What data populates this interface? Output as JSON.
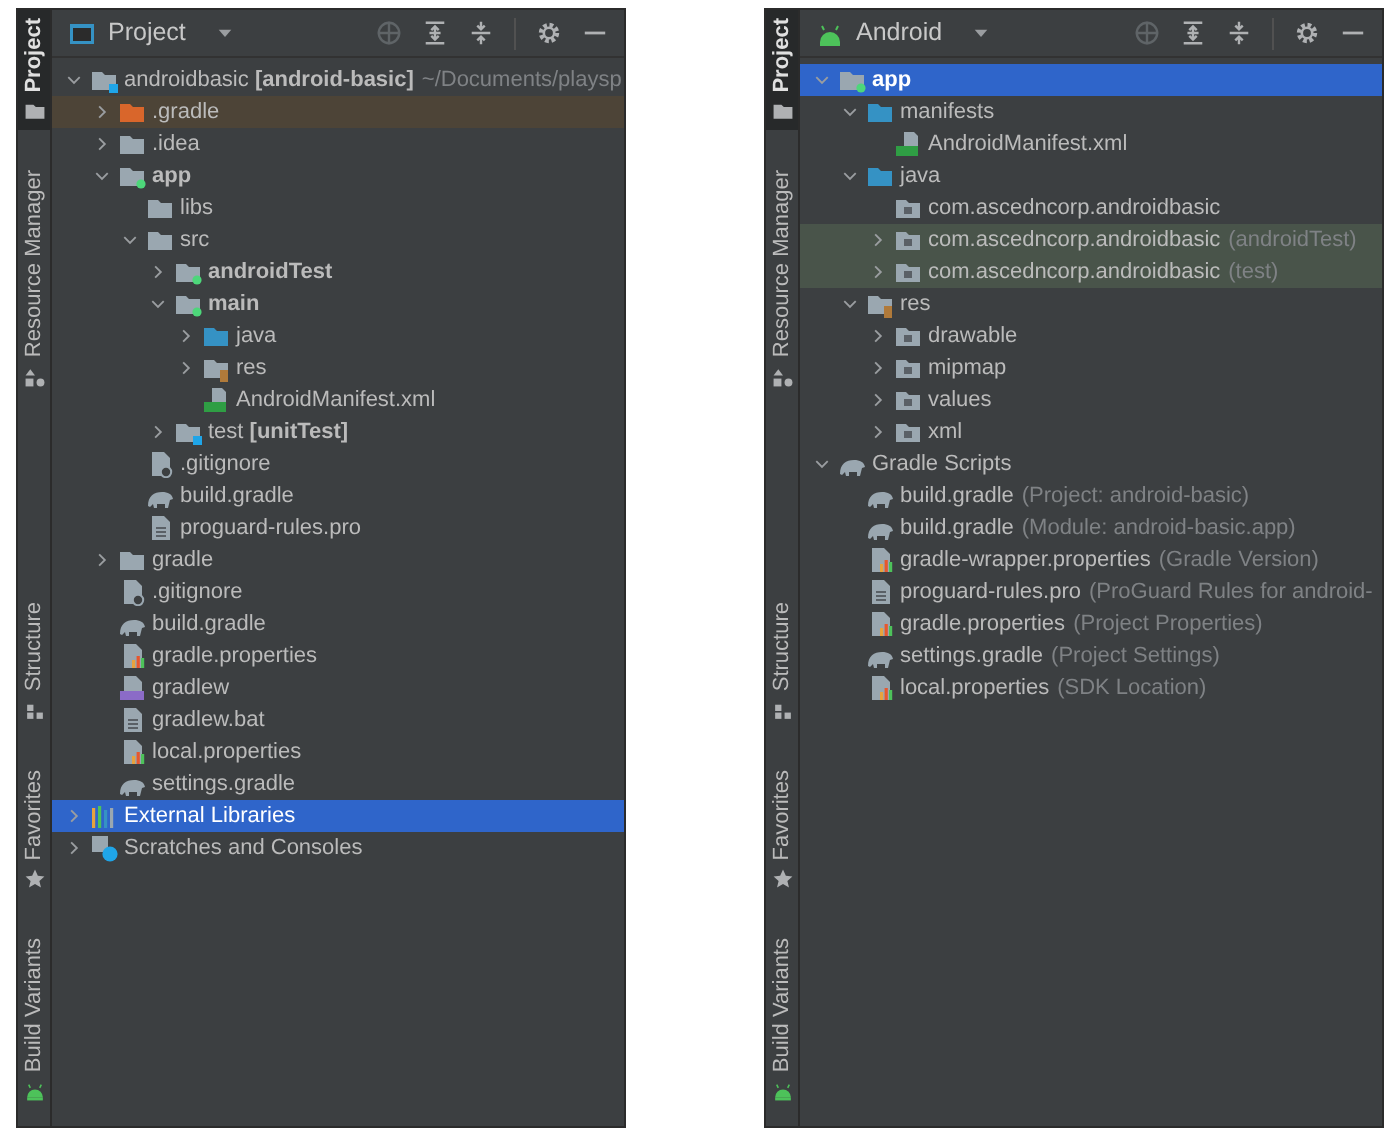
{
  "panels": [
    {
      "sidebar": {
        "top": [
          {
            "label": "Project",
            "kind": "folder",
            "selected": true
          },
          {
            "label": "Resource Manager",
            "kind": "shapes",
            "selected": false
          }
        ],
        "bottom": [
          {
            "label": "Structure",
            "kind": "structure",
            "selected": false
          },
          {
            "label": "Favorites",
            "kind": "star",
            "selected": false
          },
          {
            "label": "Build Variants",
            "kind": "android",
            "selected": false
          }
        ]
      },
      "view": {
        "label": "Project",
        "kind": "window"
      },
      "tree": [
        {
          "label": "androidbasic **[android-basic]**",
          "hint": "~/Documents/playsp",
          "kind": "module-blue",
          "expanded": true,
          "selected": false,
          "children": [
            {
              "label": ".gradle",
              "kind": "excluded",
              "expanded": false,
              "selected": false
            },
            {
              "label": ".idea",
              "kind": "folder",
              "expanded": false,
              "selected": false
            },
            {
              "label": "app",
              "bold": true,
              "kind": "module-green",
              "expanded": true,
              "selected": false,
              "children": [
                {
                  "label": "libs",
                  "kind": "folder",
                  "selected": false
                },
                {
                  "label": "src",
                  "kind": "folder",
                  "expanded": true,
                  "selected": false,
                  "children": [
                    {
                      "label": "androidTest",
                      "bold": true,
                      "kind": "module-green",
                      "expanded": false,
                      "selected": false
                    },
                    {
                      "label": "main",
                      "bold": true,
                      "kind": "module-green",
                      "expanded": true,
                      "selected": false,
                      "children": [
                        {
                          "label": "java",
                          "kind": "source-folder",
                          "expanded": false,
                          "selected": false
                        },
                        {
                          "label": "res",
                          "kind": "resource-folder",
                          "expanded": false,
                          "selected": false
                        },
                        {
                          "label": "AndroidManifest.xml",
                          "kind": "manifest",
                          "selected": false
                        }
                      ]
                    },
                    {
                      "label": "test **[unitTest]**",
                      "kind": "module-blue",
                      "expanded": false,
                      "selected": false
                    }
                  ]
                },
                {
                  "label": ".gitignore",
                  "kind": "ignore",
                  "selected": false
                },
                {
                  "label": "build.gradle",
                  "kind": "gradle",
                  "selected": false
                },
                {
                  "label": "proguard-rules.pro",
                  "kind": "file",
                  "selected": false
                }
              ]
            },
            {
              "label": "gradle",
              "kind": "folder",
              "expanded": false,
              "selected": false
            },
            {
              "label": ".gitignore",
              "kind": "ignore",
              "selected": false
            },
            {
              "label": "build.gradle",
              "kind": "gradle",
              "selected": false
            },
            {
              "label": "gradle.properties",
              "kind": "properties",
              "selected": false
            },
            {
              "label": "gradlew",
              "kind": "script",
              "selected": false
            },
            {
              "label": "gradlew.bat",
              "kind": "file",
              "selected": false
            },
            {
              "label": "local.properties",
              "kind": "properties",
              "selected": false
            },
            {
              "label": "settings.gradle",
              "kind": "gradle",
              "selected": false
            }
          ]
        },
        {
          "label": "External Libraries",
          "kind": "library",
          "expanded": false,
          "selected": true
        },
        {
          "label": "Scratches and Consoles",
          "kind": "scratch",
          "expanded": false,
          "selected": false
        }
      ]
    },
    {
      "sidebar": {
        "top": [
          {
            "label": "Project",
            "kind": "folder",
            "selected": true
          },
          {
            "label": "Resource Manager",
            "kind": "shapes",
            "selected": false
          }
        ],
        "bottom": [
          {
            "label": "Structure",
            "kind": "structure",
            "selected": false
          },
          {
            "label": "Favorites",
            "kind": "star",
            "selected": false
          },
          {
            "label": "Build Variants",
            "kind": "android",
            "selected": false
          }
        ]
      },
      "view": {
        "label": "Android",
        "kind": "android"
      },
      "tree": [
        {
          "label": "app",
          "bold": true,
          "kind": "module-green",
          "expanded": true,
          "selected": true,
          "children": [
            {
              "label": "manifests",
              "kind": "source-folder",
              "expanded": true,
              "selected": false,
              "children": [
                {
                  "label": "AndroidManifest.xml",
                  "kind": "manifest",
                  "selected": false
                }
              ]
            },
            {
              "label": "java",
              "kind": "source-folder",
              "expanded": true,
              "selected": false,
              "children": [
                {
                  "label": "com.ascedncorp.androidbasic",
                  "kind": "package",
                  "selected": false
                },
                {
                  "label": "com.ascedncorp.androidbasic",
                  "hint": "(androidTest)",
                  "kind": "testpackage",
                  "expanded": false,
                  "selected": false
                },
                {
                  "label": "com.ascedncorp.androidbasic",
                  "hint": "(test)",
                  "kind": "testpackage",
                  "expanded": false,
                  "selected": false
                }
              ]
            },
            {
              "label": "res",
              "kind": "resource-folder",
              "expanded": true,
              "selected": false,
              "children": [
                {
                  "label": "drawable",
                  "kind": "package",
                  "expanded": false,
                  "selected": false
                },
                {
                  "label": "mipmap",
                  "kind": "package",
                  "expanded": false,
                  "selected": false
                },
                {
                  "label": "values",
                  "kind": "package",
                  "expanded": false,
                  "selected": false
                },
                {
                  "label": "xml",
                  "kind": "package",
                  "expanded": false,
                  "selected": false
                }
              ]
            }
          ]
        },
        {
          "label": "Gradle Scripts",
          "kind": "gradle",
          "expanded": true,
          "selected": false,
          "children": [
            {
              "label": "build.gradle",
              "hint": "(Project: android-basic)",
              "kind": "gradle",
              "selected": false
            },
            {
              "label": "build.gradle",
              "hint": "(Module: android-basic.app)",
              "kind": "gradle",
              "selected": false
            },
            {
              "label": "gradle-wrapper.properties",
              "hint": "(Gradle Version)",
              "kind": "properties",
              "selected": false
            },
            {
              "label": "proguard-rules.pro",
              "hint": "(ProGuard Rules for android-",
              "kind": "file",
              "selected": false
            },
            {
              "label": "gradle.properties",
              "hint": "(Project Properties)",
              "kind": "properties",
              "selected": false
            },
            {
              "label": "settings.gradle",
              "hint": "(Project Settings)",
              "kind": "gradle",
              "selected": false
            },
            {
              "label": "local.properties",
              "hint": "(SDK Location)",
              "kind": "properties",
              "selected": false
            }
          ]
        }
      ]
    }
  ]
}
